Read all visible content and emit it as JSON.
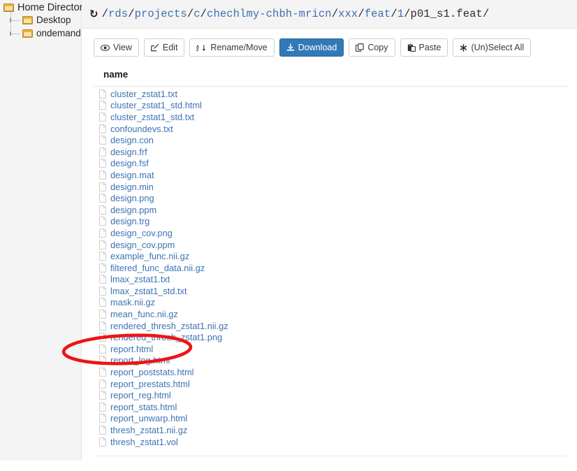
{
  "sidebar": {
    "root": {
      "label": "Home Directory",
      "icon": "folder-icon"
    },
    "items": [
      {
        "label": "Desktop",
        "icon": "folder-icon"
      },
      {
        "label": "ondemand",
        "icon": "folder-icon"
      }
    ]
  },
  "header": {
    "refresh_icon": "refresh-icon",
    "path": "/rds/projects/c/chechlmy-chbh-mricn/xxx/feat/1/p01_s1.feat/",
    "path_segments": [
      "rds",
      "projects",
      "c",
      "chechlmy-chbh-mricn",
      "xxx",
      "feat",
      "1"
    ],
    "path_last": "p01_s1.feat"
  },
  "toolbar": {
    "buttons": [
      {
        "label": "View",
        "icon": "eye-icon",
        "primary": false
      },
      {
        "label": "Edit",
        "icon": "pencil-square-icon",
        "primary": false
      },
      {
        "label": "Rename/Move",
        "icon": "sort-alpha-icon",
        "primary": false
      },
      {
        "label": "Download",
        "icon": "download-icon",
        "primary": true
      },
      {
        "label": "Copy",
        "icon": "copy-icon",
        "primary": false
      },
      {
        "label": "Paste",
        "icon": "clipboard-icon",
        "primary": false
      },
      {
        "label": "(Un)Select All",
        "icon": "asterisk-icon",
        "primary": false
      }
    ]
  },
  "table": {
    "column_header": "name",
    "files": [
      "cluster_zstat1.txt",
      "cluster_zstat1_std.html",
      "cluster_zstat1_std.txt",
      "confoundevs.txt",
      "design.con",
      "design.frf",
      "design.fsf",
      "design.mat",
      "design.min",
      "design.png",
      "design.ppm",
      "design.trg",
      "design_cov.png",
      "design_cov.ppm",
      "example_func.nii.gz",
      "filtered_func_data.nii.gz",
      "lmax_zstat1.txt",
      "lmax_zstat1_std.txt",
      "mask.nii.gz",
      "mean_func.nii.gz",
      "rendered_thresh_zstat1.nii.gz",
      "rendered_thresh_zstat1.png",
      "report.html",
      "report_log.html",
      "report_poststats.html",
      "report_prestats.html",
      "report_reg.html",
      "report_stats.html",
      "report_unwarp.html",
      "thresh_zstat1.nii.gz",
      "thresh_zstat1.vol"
    ]
  },
  "annotation": {
    "type": "ellipse",
    "target": "report.html",
    "color": "#ee1414"
  },
  "colors": {
    "link": "#3b72b2",
    "primary_button": "#3279b7",
    "sidebar_bg": "#f4f4f4",
    "annotation_red": "#ee1414"
  }
}
